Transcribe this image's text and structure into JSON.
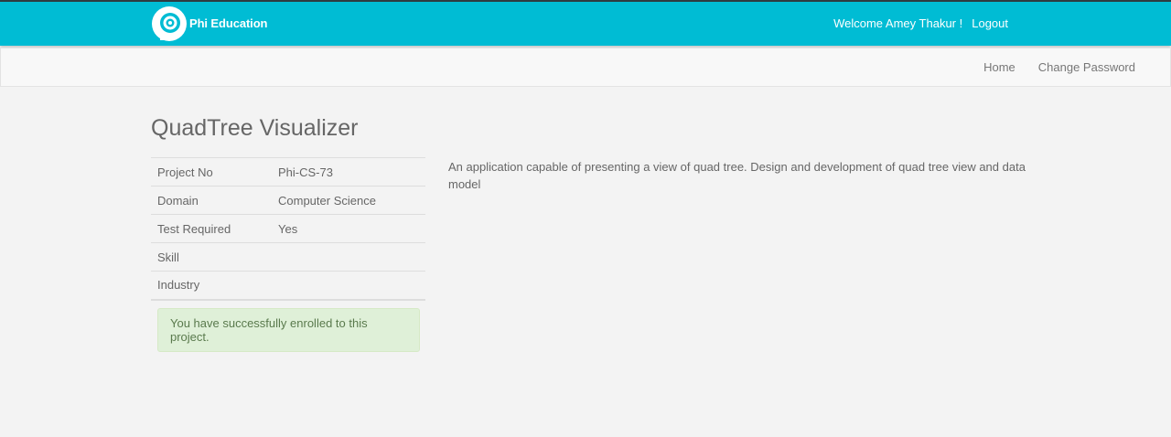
{
  "header": {
    "brand": "Phi Education",
    "welcome": "Welcome Amey Thakur !",
    "logout": "Logout",
    "accent_color": "#00bcd4"
  },
  "subnav": {
    "items": [
      {
        "label": "Home"
      },
      {
        "label": "Change Password"
      }
    ]
  },
  "project": {
    "title": "QuadTree Visualizer",
    "details": [
      {
        "key": "Project No",
        "value": "Phi-CS-73"
      },
      {
        "key": "Domain",
        "value": "Computer Science"
      },
      {
        "key": "Test Required",
        "value": "Yes"
      },
      {
        "key": "Skill",
        "value": ""
      },
      {
        "key": "Industry",
        "value": ""
      }
    ],
    "enroll_message": "You have successfully enrolled to this project.",
    "description": "An application capable of presenting a view of quad tree. Design and development of quad tree view and data model"
  }
}
